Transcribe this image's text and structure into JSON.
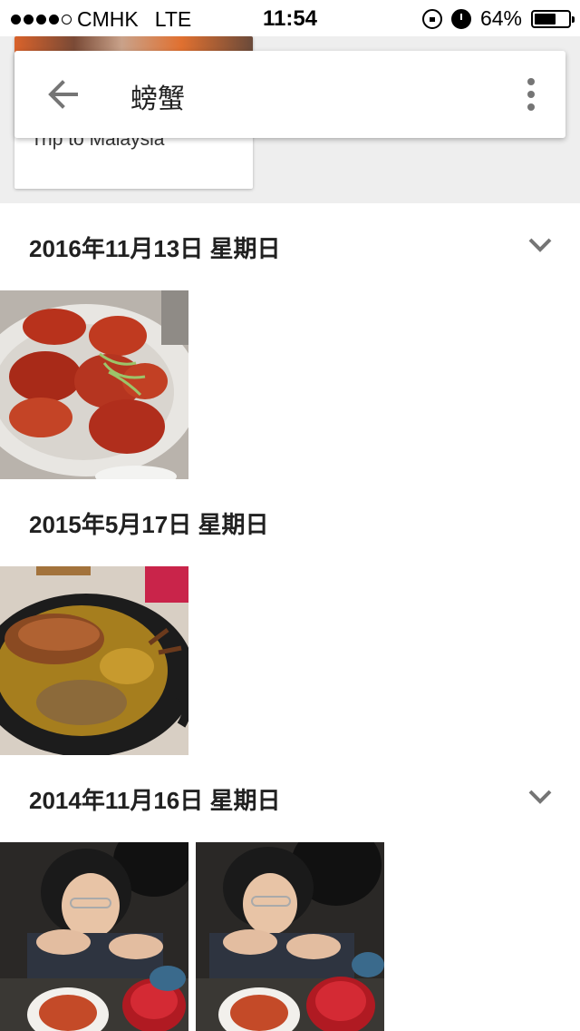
{
  "status_bar": {
    "carrier": "CMHK",
    "network": "LTE",
    "time": "11:54",
    "battery": "64%",
    "battery_level": 0.64
  },
  "search": {
    "query": "螃蟹"
  },
  "album": {
    "title": "Trip to Malaysia"
  },
  "sections": [
    {
      "date": "2016年11月13日 星期日",
      "has_expand": true,
      "photo_count": 1
    },
    {
      "date": "2015年5月17日 星期日",
      "has_expand": false,
      "photo_count": 1
    },
    {
      "date": "2014年11月16日 星期日",
      "has_expand": true,
      "photo_count": 2
    }
  ],
  "icons": {
    "back": "arrow-left-icon",
    "more": "more-vert-icon",
    "expand": "chevron-down-icon"
  },
  "colors": {
    "background": "#ffffff",
    "album_strip": "#eeeeee",
    "text": "#212121",
    "icon": "#757575"
  }
}
